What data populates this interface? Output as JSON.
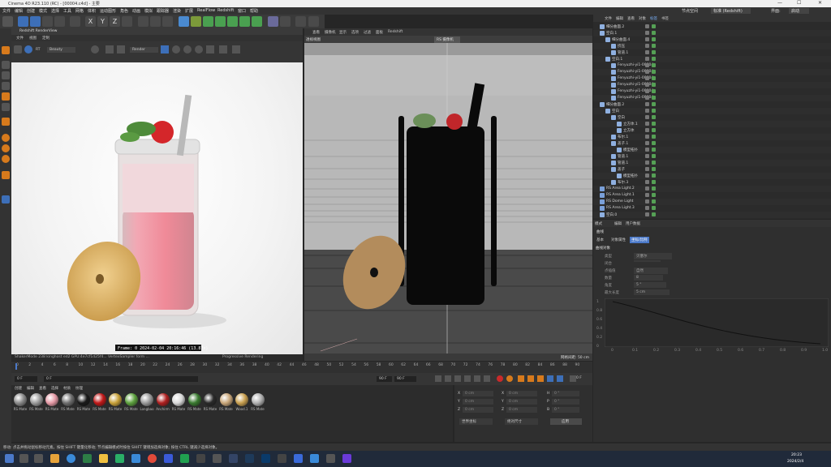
{
  "window": {
    "title": "Cinema 4D R23.110 (RC) - [00004.c4d] - 主要",
    "controls": [
      "—",
      "☐",
      "✕"
    ]
  },
  "menu": [
    "文件",
    "编辑",
    "创建",
    "模式",
    "选择",
    "工具",
    "网格",
    "体积",
    "运动图形",
    "角色",
    "动画",
    "模拟",
    "跟踪器",
    "渲染",
    "扩展",
    "RealFlow",
    "Redshift",
    "窗口",
    "帮助"
  ],
  "menu_right": {
    "label": "节点空间",
    "value": "标准 (Redshift)",
    "layout_label": "界面:",
    "layout_value": "启动"
  },
  "renderview": {
    "title": "Redshift RenderView",
    "menu": [
      "文件",
      "视图",
      "定制"
    ],
    "toolbar_dropdown1": "Beauty",
    "toolbar_dropdown2": "Render",
    "rt_label": "RT",
    "frame_text": "Frame: 0   2024-02-04  20:16:46  (13.87s)",
    "status_text": "ShakerMode 238 kinghost ed2 GPU:4e7cf1d25f4... VertexSampler form ...",
    "status_right": "Progressive Rendering"
  },
  "viewport": {
    "tabs": [
      "查看",
      "摄像机",
      "显示",
      "选项",
      "过滤",
      "面板",
      "Redshift"
    ],
    "camera_label": "透视视图",
    "camera_badge": "RS 摄像机",
    "grid_label": "网格间距: 50 cm"
  },
  "objects": {
    "tabs": [
      "文件",
      "编辑",
      "查看",
      "对象",
      "标签",
      "书签"
    ],
    "rows": [
      {
        "name": "细分曲面.2",
        "indent": 0
      },
      {
        "name": "空白.1",
        "indent": 0
      },
      {
        "name": "细分曲面.4",
        "indent": 1
      },
      {
        "name": "挤压",
        "indent": 2
      },
      {
        "name": "管道.1",
        "indent": 2
      },
      {
        "name": "空白.1",
        "indent": 1
      },
      {
        "name": "Fenyuzhi-yi1-00004",
        "indent": 2
      },
      {
        "name": "Fenyuzhi-yi1-00004",
        "indent": 2
      },
      {
        "name": "Fenyuzhi-yi1-00004",
        "indent": 2
      },
      {
        "name": "Fenyuzhi-yi1-00004",
        "indent": 2
      },
      {
        "name": "Fenyuzhi-yi1-00004",
        "indent": 2
      },
      {
        "name": "Fenyuzhi-yi1-00004",
        "indent": 2
      },
      {
        "name": "细分曲面.2",
        "indent": 0
      },
      {
        "name": "空白",
        "indent": 1
      },
      {
        "name": "空白",
        "indent": 2
      },
      {
        "name": "立方体.1",
        "indent": 3
      },
      {
        "name": "立方体",
        "indent": 3
      },
      {
        "name": "布尔.1",
        "indent": 2
      },
      {
        "name": "盖子.1",
        "indent": 2
      },
      {
        "name": "模型拓扑",
        "indent": 3
      },
      {
        "name": "管道.1",
        "indent": 2
      },
      {
        "name": "管道.1",
        "indent": 2
      },
      {
        "name": "盖子",
        "indent": 2
      },
      {
        "name": "模型拓扑",
        "indent": 3
      },
      {
        "name": "布尔.3",
        "indent": 2
      },
      {
        "name": "RS Area Light.2",
        "indent": 0
      },
      {
        "name": "RS Area Light.1",
        "indent": 0
      },
      {
        "name": "RS Dome Light",
        "indent": 0
      },
      {
        "name": "RS Area Light.3",
        "indent": 0
      },
      {
        "name": "空白.0",
        "indent": 0
      }
    ]
  },
  "attributes": {
    "tabs": [
      "模式",
      "编辑",
      "用户数据"
    ],
    "object_label": "曲线",
    "subtabs": [
      "基本",
      "对象属性",
      "坐标/比例"
    ],
    "section": "曲线对象",
    "fields": [
      {
        "label": "类型",
        "value": "贝塞尔"
      },
      {
        "label": "闭合",
        "value": ""
      },
      {
        "label": "点插值",
        "value": "自然"
      },
      {
        "label": "数量",
        "value": "8"
      },
      {
        "label": "角度",
        "value": "5 °"
      },
      {
        "label": "最大长度",
        "value": "5 cm"
      }
    ],
    "graph_y": [
      "1",
      "0.8",
      "0.6",
      "0.4",
      "0.2",
      "0"
    ],
    "graph_x": [
      "0",
      "0.1",
      "0.2",
      "0.3",
      "0.4",
      "0.5",
      "0.6",
      "0.7",
      "0.8",
      "0.9",
      "1.0"
    ]
  },
  "timeline": {
    "ticks": [
      "0",
      "2",
      "4",
      "6",
      "8",
      "10",
      "12",
      "14",
      "16",
      "18",
      "20",
      "22",
      "24",
      "26",
      "28",
      "30",
      "32",
      "34",
      "36",
      "38",
      "40",
      "42",
      "44",
      "46",
      "48",
      "50",
      "52",
      "54",
      "56",
      "58",
      "60",
      "62",
      "64",
      "66",
      "68",
      "70",
      "72",
      "74",
      "76",
      "78",
      "80",
      "82",
      "84",
      "86",
      "88",
      "90"
    ],
    "start": "0 F",
    "current": "0 F",
    "end": "90 F",
    "end2": "90 F",
    "frame_readout": "0 F"
  },
  "materials": {
    "menu": [
      "创建",
      "编辑",
      "查看",
      "选择",
      "材质",
      "纹理"
    ],
    "items": [
      {
        "name": "RS Mate",
        "color": "#8a8a8a"
      },
      {
        "name": "RS Mate",
        "color": "#9b9b9b"
      },
      {
        "name": "RS Mate",
        "color": "#e59aa6"
      },
      {
        "name": "RS Mate",
        "color": "#6f6f6f"
      },
      {
        "name": "RS Mate",
        "color": "#1a1a1a"
      },
      {
        "name": "RS Mate",
        "color": "#c01818"
      },
      {
        "name": "RS Mate",
        "color": "#c8a13a"
      },
      {
        "name": "RS Mate",
        "color": "#5da13e"
      },
      {
        "name": "Longbao",
        "color": "#9a9a9a"
      },
      {
        "name": "Anchirm",
        "color": "#b02020"
      },
      {
        "name": "RS Mate",
        "color": "#d8d8d8"
      },
      {
        "name": "RS Mate",
        "color": "#3a7a30"
      },
      {
        "name": "RS Mate",
        "color": "#2a2a2a"
      },
      {
        "name": "RS Mate",
        "color": "#c9a77a"
      },
      {
        "name": "Wood.1",
        "color": "#c9a050"
      },
      {
        "name": "RS Mate",
        "color": "#b0b0b0"
      }
    ]
  },
  "coords": {
    "rows": [
      {
        "a": "X",
        "av": "0 cm",
        "b": "X",
        "bv": "0 cm",
        "c": "H",
        "cv": "0 °"
      },
      {
        "a": "Y",
        "av": "0 cm",
        "b": "Y",
        "bv": "0 cm",
        "c": "P",
        "cv": "0 °"
      },
      {
        "a": "Z",
        "av": "0 cm",
        "b": "Z",
        "bv": "0 cm",
        "c": "B",
        "cv": "0 °"
      }
    ],
    "mode1": "世界坐标",
    "mode2": "绝对尺寸",
    "apply": "应用"
  },
  "status": "移动: 点击并拖动鼠标移动元素。按住 SHIFT 键量化移动; 节点编辑模式时按住 SHIFT 键增加选择对象; 按住 CTRL 键减少选择对象。",
  "clock": {
    "time": "20:23",
    "date": "2024/2/4"
  },
  "colors": {
    "accent": "#4b79c9",
    "bg": "#262626",
    "render_bg": "#f2f2f2",
    "taskbar": "#202a3a"
  }
}
